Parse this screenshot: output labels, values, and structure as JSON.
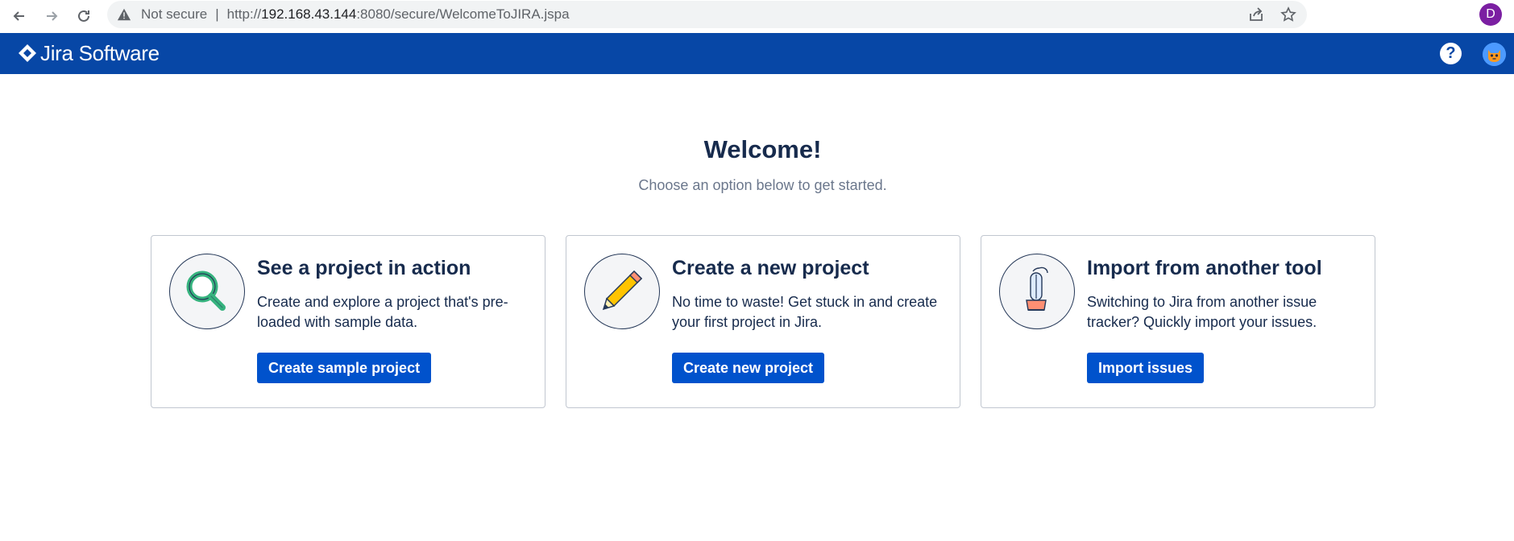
{
  "browser": {
    "security_label": "Not secure",
    "url_prefix": "http://",
    "url_host": "192.168.43.144",
    "url_path": ":8080/secure/WelcomeToJIRA.jspa",
    "profile_initial": "D"
  },
  "header": {
    "brand": "Jira Software",
    "help_label": "?",
    "colors": {
      "bar": "#0747a6"
    }
  },
  "main": {
    "title": "Welcome!",
    "subtitle": "Choose an option below to get started.",
    "cards": [
      {
        "icon": "magnifier-icon",
        "title": "See a project in action",
        "description": "Create and explore a project that's pre-loaded with sample data.",
        "button": "Create sample project"
      },
      {
        "icon": "pencil-icon",
        "title": "Create a new project",
        "description": "No time to waste! Get stuck in and create your first project in Jira.",
        "button": "Create new project"
      },
      {
        "icon": "vacuum-icon",
        "title": "Import from another tool",
        "description": "Switching to Jira from another issue tracker? Quickly import your issues.",
        "button": "Import issues"
      }
    ],
    "colors": {
      "button": "#0052cc",
      "title": "#172b4d",
      "subtitle": "#6b778c"
    }
  }
}
